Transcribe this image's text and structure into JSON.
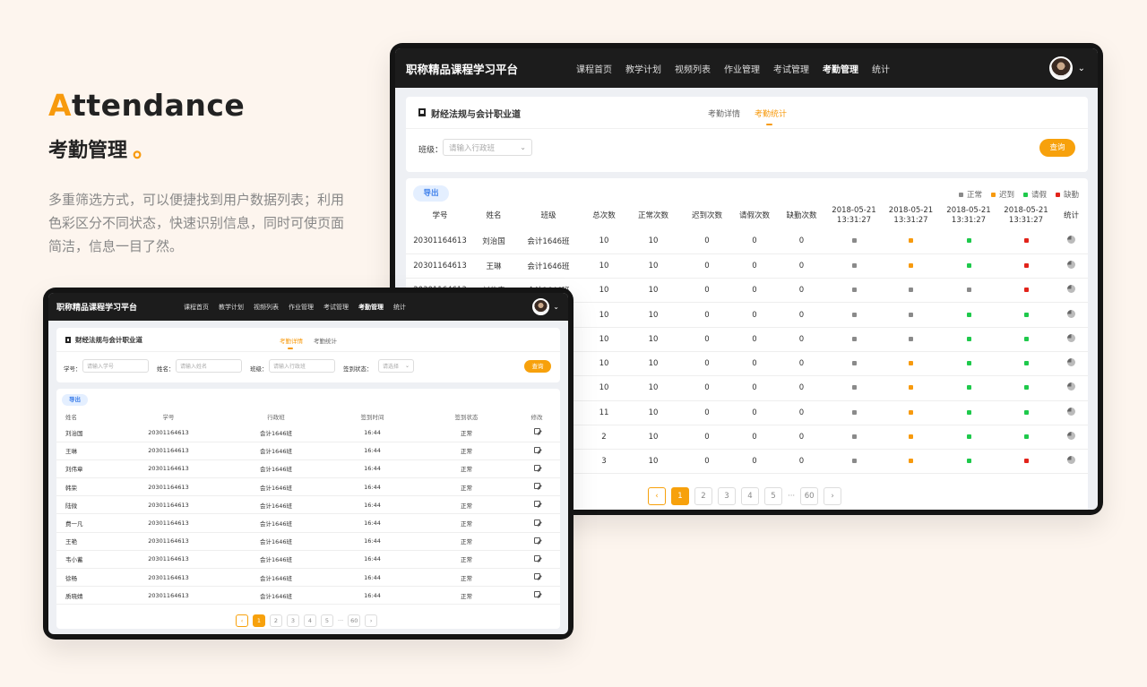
{
  "hero": {
    "first_letter": "A",
    "title_rest": "ttendance",
    "subtitle": "考勤管理",
    "subtitle_dot": "。",
    "description": "多重筛选方式，可以便捷找到用户数据列表；利用色彩区分不同状态，快速识别信息，同时可使页面简洁，信息一目了然。"
  },
  "app": {
    "brand": "职称精品课程学习平台",
    "nav": [
      "课程首页",
      "教学计划",
      "视频列表",
      "作业管理",
      "考试管理",
      "考勤管理",
      "统计"
    ],
    "active_nav": "考勤管理",
    "course_title": "财经法规与会计职业道",
    "tabs": [
      "考勤详情",
      "考勤统计"
    ],
    "query_button": "查询",
    "export_button": "导出",
    "caret": "⌄"
  },
  "big": {
    "active_tab": "考勤统计",
    "filter": {
      "label": "班级：",
      "placeholder": "请输入行政班"
    },
    "legend": [
      {
        "label": "正常",
        "color": "#8a8a8a"
      },
      {
        "label": "迟到",
        "color": "#f79a0e"
      },
      {
        "label": "请假",
        "color": "#1ec94b"
      },
      {
        "label": "缺勤",
        "color": "#e2231a"
      }
    ],
    "columns": [
      "学号",
      "姓名",
      "班级",
      "总次数",
      "正常次数",
      "迟到次数",
      "请假次数",
      "缺勤次数",
      "2018-05-21 13:31:27",
      "2018-05-21 13:31:27",
      "2018-05-21 13:31:27",
      "2018-05-21 13:31:27",
      "统计"
    ],
    "rows": [
      {
        "id": "20301164613",
        "name": "刘治国",
        "cls": "会计1646班",
        "total": "10",
        "normal": "10",
        "late": "0",
        "leave": "0",
        "absent": "0",
        "s": [
          "#8a8a8a",
          "#f79a0e",
          "#1ec94b",
          "#e2231a"
        ]
      },
      {
        "id": "20301164613",
        "name": "王琳",
        "cls": "会计1646班",
        "total": "10",
        "normal": "10",
        "late": "0",
        "leave": "0",
        "absent": "0",
        "s": [
          "#8a8a8a",
          "#f79a0e",
          "#1ec94b",
          "#e2231a"
        ]
      },
      {
        "id": "20301164613",
        "name": "刘伟章",
        "cls": "会计1646班",
        "total": "10",
        "normal": "10",
        "late": "0",
        "leave": "0",
        "absent": "0",
        "s": [
          "#8a8a8a",
          "#8a8a8a",
          "#8a8a8a",
          "#e2231a"
        ]
      },
      {
        "id": "",
        "name": "",
        "cls": "",
        "total": "10",
        "normal": "10",
        "late": "0",
        "leave": "0",
        "absent": "0",
        "s": [
          "#8a8a8a",
          "#8a8a8a",
          "#1ec94b",
          "#1ec94b"
        ]
      },
      {
        "id": "",
        "name": "",
        "cls": "",
        "total": "10",
        "normal": "10",
        "late": "0",
        "leave": "0",
        "absent": "0",
        "s": [
          "#8a8a8a",
          "#8a8a8a",
          "#1ec94b",
          "#1ec94b"
        ]
      },
      {
        "id": "",
        "name": "",
        "cls": "",
        "total": "10",
        "normal": "10",
        "late": "0",
        "leave": "0",
        "absent": "0",
        "s": [
          "#8a8a8a",
          "#f79a0e",
          "#1ec94b",
          "#1ec94b"
        ]
      },
      {
        "id": "",
        "name": "",
        "cls": "",
        "total": "10",
        "normal": "10",
        "late": "0",
        "leave": "0",
        "absent": "0",
        "s": [
          "#8a8a8a",
          "#f79a0e",
          "#1ec94b",
          "#1ec94b"
        ]
      },
      {
        "id": "",
        "name": "",
        "cls": "",
        "total": "11",
        "normal": "10",
        "late": "0",
        "leave": "0",
        "absent": "0",
        "s": [
          "#8a8a8a",
          "#f79a0e",
          "#1ec94b",
          "#1ec94b"
        ]
      },
      {
        "id": "",
        "name": "",
        "cls": "",
        "total": "2",
        "normal": "10",
        "late": "0",
        "leave": "0",
        "absent": "0",
        "s": [
          "#8a8a8a",
          "#f79a0e",
          "#1ec94b",
          "#1ec94b"
        ]
      },
      {
        "id": "",
        "name": "",
        "cls": "",
        "total": "3",
        "normal": "10",
        "late": "0",
        "leave": "0",
        "absent": "0",
        "s": [
          "#8a8a8a",
          "#f79a0e",
          "#1ec94b",
          "#e2231a"
        ]
      }
    ],
    "pager": {
      "prev": "‹",
      "pages": [
        "1",
        "2",
        "3",
        "4",
        "5"
      ],
      "ellipsis": "···",
      "last": "60",
      "next": "›",
      "current": "1"
    }
  },
  "small": {
    "active_tab": "考勤详情",
    "filters": [
      {
        "label": "学号：",
        "placeholder": "请输入学号"
      },
      {
        "label": "姓名：",
        "placeholder": "请输入姓名"
      },
      {
        "label": "班级：",
        "placeholder": "请输入行政班"
      },
      {
        "label": "签到状态：",
        "placeholder": "请选择"
      }
    ],
    "columns": [
      "姓名",
      "学号",
      "行政班",
      "签到时间",
      "签到状态",
      "修改"
    ],
    "rows": [
      {
        "name": "刘治国",
        "id": "20301164613",
        "cls": "会计1646班",
        "time": "16:44",
        "status": "正常"
      },
      {
        "name": "王琳",
        "id": "20301164613",
        "cls": "会计1646班",
        "time": "16:44",
        "status": "正常"
      },
      {
        "name": "刘伟章",
        "id": "20301164613",
        "cls": "会计1646班",
        "time": "16:44",
        "status": "正常"
      },
      {
        "name": "韩荣",
        "id": "20301164613",
        "cls": "会计1646班",
        "time": "16:44",
        "status": "正常"
      },
      {
        "name": "陆微",
        "id": "20301164613",
        "cls": "会计1646班",
        "time": "16:44",
        "status": "正常"
      },
      {
        "name": "费一凡",
        "id": "20301164613",
        "cls": "会计1646班",
        "time": "16:44",
        "status": "正常"
      },
      {
        "name": "王艳",
        "id": "20301164613",
        "cls": "会计1646班",
        "time": "16:44",
        "status": "正常"
      },
      {
        "name": "韦小蓄",
        "id": "20301164613",
        "cls": "会计1646班",
        "time": "16:44",
        "status": "正常"
      },
      {
        "name": "徐畅",
        "id": "20301164613",
        "cls": "会计1646班",
        "time": "16:44",
        "status": "正常"
      },
      {
        "name": "质晓婧",
        "id": "20301164613",
        "cls": "会计1646班",
        "time": "16:44",
        "status": "正常"
      }
    ],
    "pager": {
      "prev": "‹",
      "pages": [
        "1",
        "2",
        "3",
        "4",
        "5"
      ],
      "ellipsis": "···",
      "last": "60",
      "next": "›",
      "current": "1"
    }
  }
}
